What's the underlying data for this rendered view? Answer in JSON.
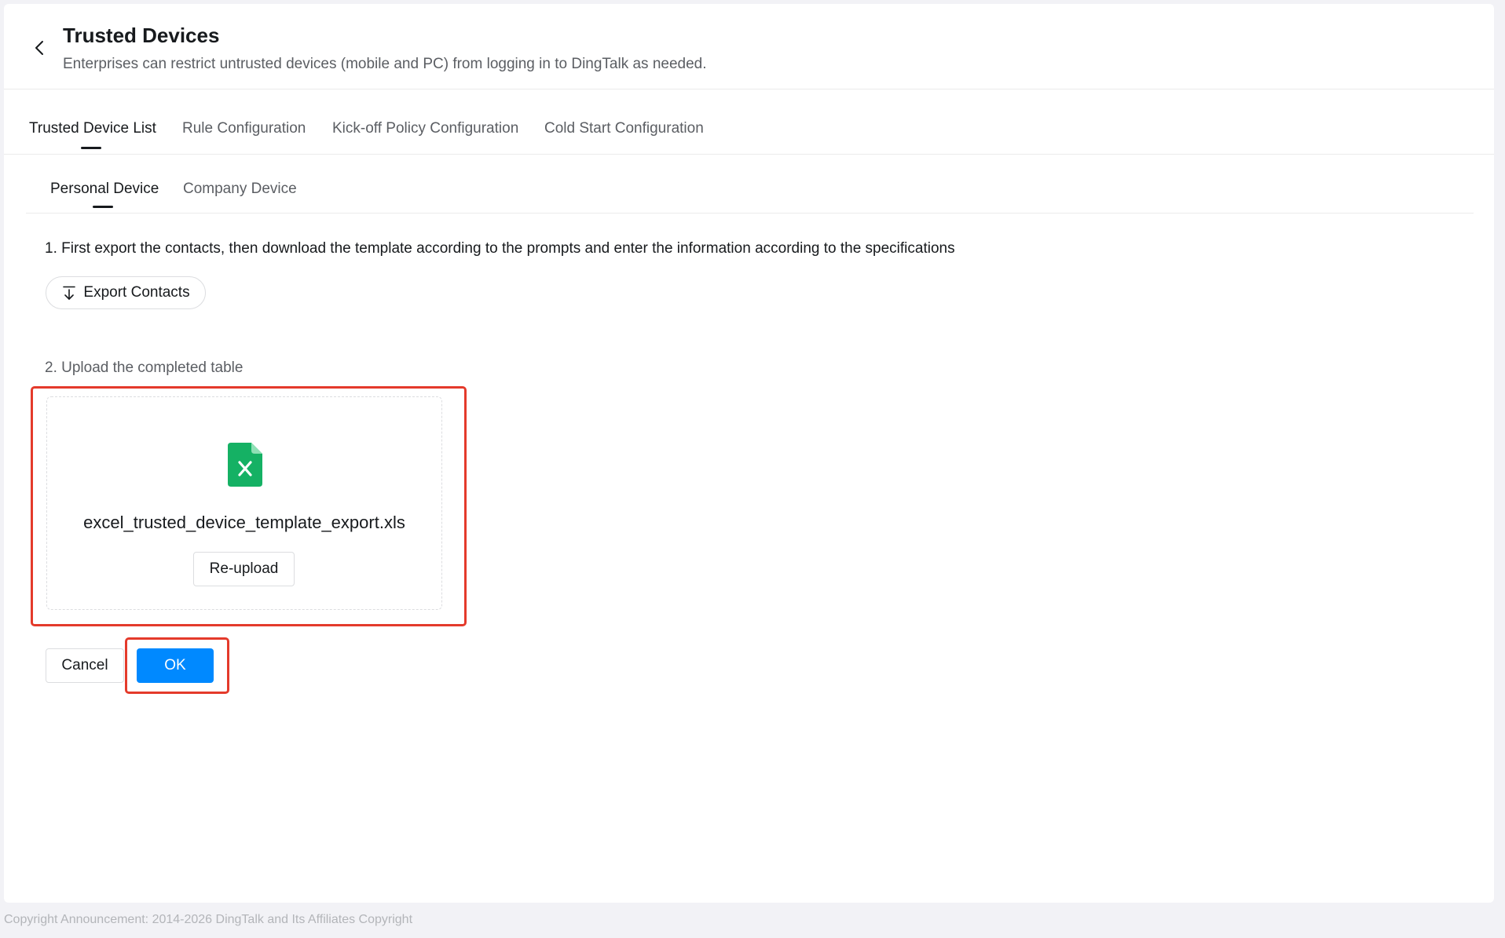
{
  "header": {
    "title": "Trusted Devices",
    "subtitle": "Enterprises can restrict untrusted devices (mobile and PC) from logging in to DingTalk as needed."
  },
  "tabs": [
    {
      "label": "Trusted Device List",
      "active": true
    },
    {
      "label": "Rule Configuration",
      "active": false
    },
    {
      "label": "Kick-off Policy Configuration",
      "active": false
    },
    {
      "label": "Cold Start Configuration",
      "active": false
    }
  ],
  "subtabs": [
    {
      "label": "Personal Device",
      "active": true
    },
    {
      "label": "Company Device",
      "active": false
    }
  ],
  "steps": {
    "step1": "1. First export the contacts, then download the template according to the prompts and enter the information according to the specifications",
    "export_label": "Export Contacts",
    "step2": "2. Upload the completed table"
  },
  "upload": {
    "file_name": "excel_trusted_device_template_export.xls",
    "file_icon": "excel-file-icon",
    "reupload_label": "Re-upload"
  },
  "actions": {
    "cancel_label": "Cancel",
    "ok_label": "OK"
  },
  "footer": {
    "text": "Copyright Announcement: 2014-2026 DingTalk and Its Affiliates Copyright"
  },
  "colors": {
    "primary": "#0089ff",
    "highlight": "#e43a2b",
    "excel_green": "#15b164"
  }
}
